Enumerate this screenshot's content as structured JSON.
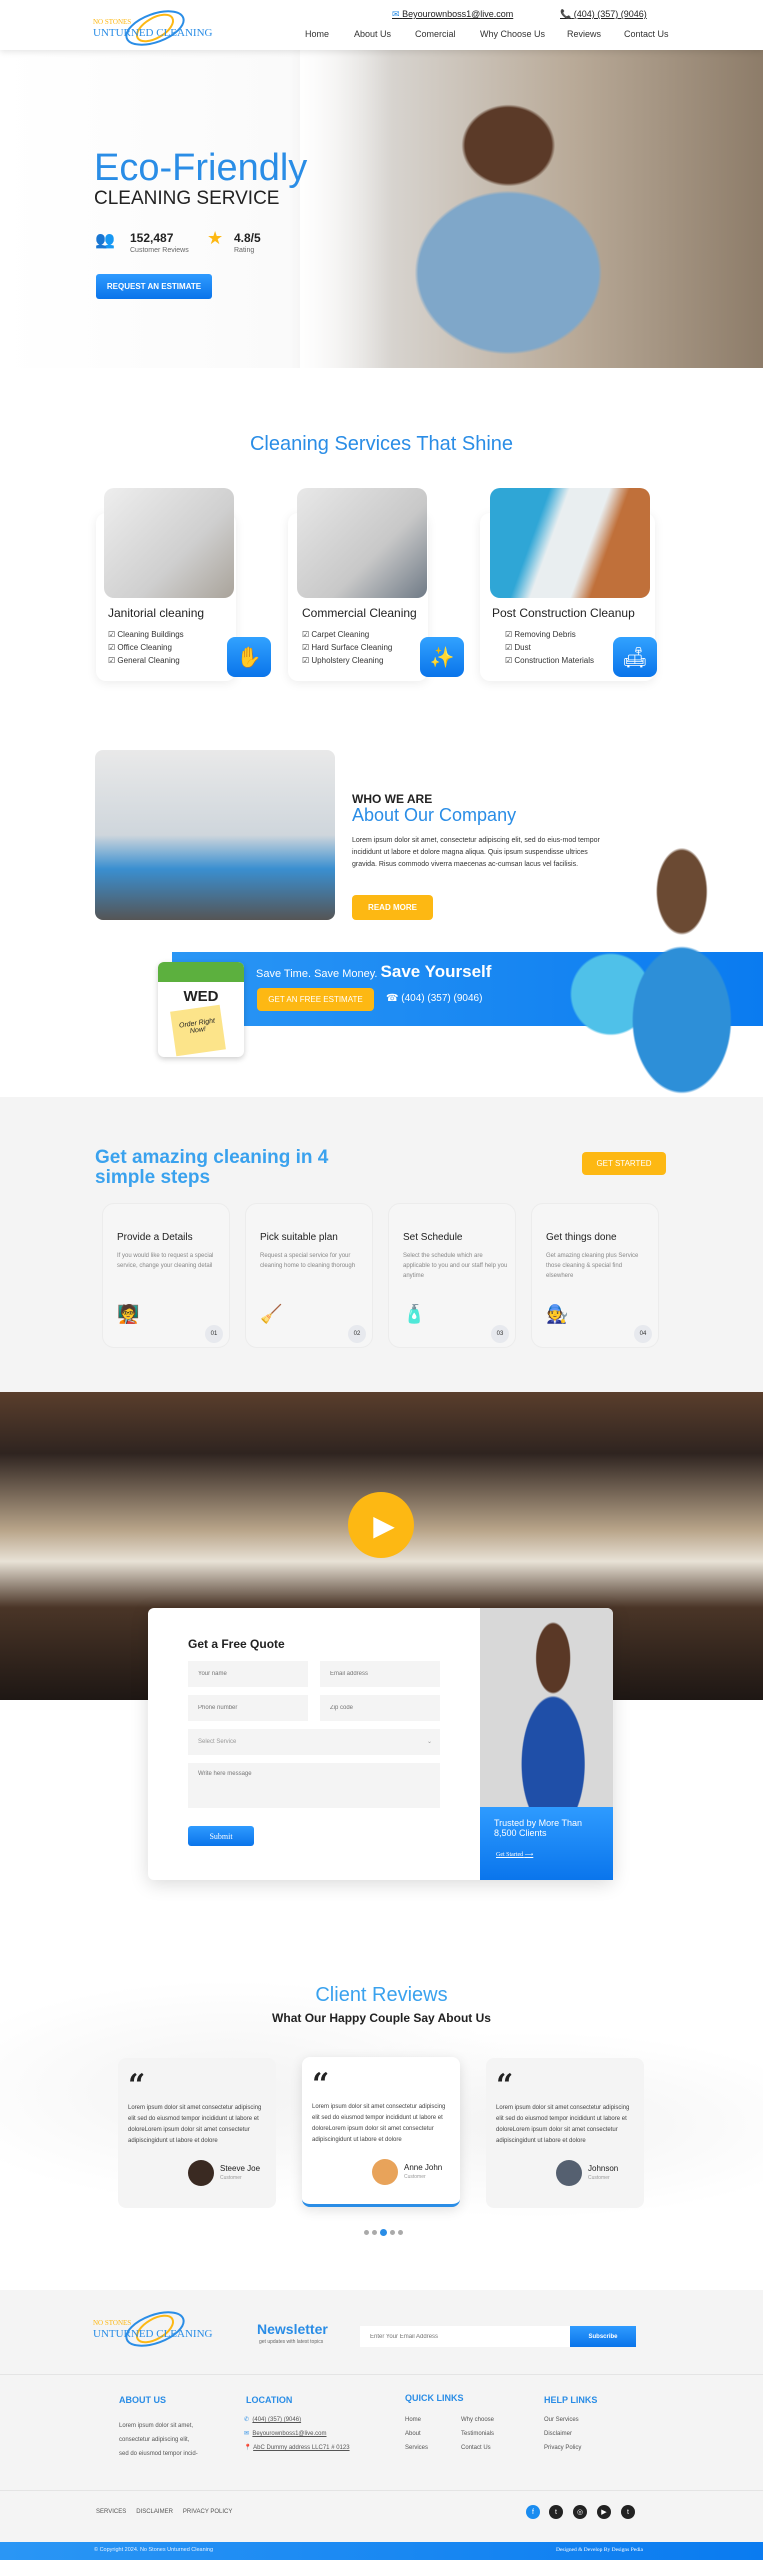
{
  "header": {
    "logo_text": "NO STONES UNTURNED CLEANING",
    "email": "Beyourownboss1@live.com",
    "phone": "(404) (357) (9046)",
    "nav": [
      "Home",
      "About Us",
      "Comercial",
      "Why Choose Us",
      "Reviews",
      "Contact Us"
    ]
  },
  "hero": {
    "title": "Eco-Friendly",
    "subtitle": "CLEANING SERVICE",
    "reviews_count": "152,487",
    "reviews_label": "Customer Reviews",
    "rating": "4.8/5",
    "rating_label": "Rating",
    "cta": "REQUEST AN ESTIMATE"
  },
  "services": {
    "title": "Cleaning Services That Shine",
    "cards": [
      {
        "title": "Janitorial cleaning",
        "items": [
          "Cleaning Buildings",
          "Office Cleaning",
          "General Cleaning"
        ],
        "icon": "hand-wipe-icon"
      },
      {
        "title": "Commercial Cleaning",
        "items": [
          "Carpet Cleaning",
          "Hard Surface Cleaning",
          "Upholstery Cleaning"
        ],
        "icon": "office-sparkle-icon"
      },
      {
        "title": "Post Construction Cleanup",
        "items": [
          "Removing Debris",
          "Dust",
          "Construction Materials"
        ],
        "icon": "sofa-clean-icon"
      }
    ]
  },
  "about": {
    "eyebrow": "WHO WE ARE",
    "title": "About Our Company",
    "body": "Lorem ipsum dolor sit amet, consectetur adipiscing elit, sed do eius-mod tempor incididunt ut labore et dolore magna aliqua. Quis ipsum suspendisse ultrices gravida. Risus commodo viverra maecenas ac-cumsan lacus vel facilisis.",
    "button": "READ MORE"
  },
  "banner": {
    "tagline": "Save Time. Save Money.",
    "tagline_bold": "Save Yourself",
    "button": "GET AN FREE ESTIMATE",
    "phone": "(404) (357) (9046)",
    "calendar_day": "WED",
    "note": "Order Right Now!"
  },
  "steps": {
    "title": "Get amazing cleaning in 4 simple steps",
    "button": "GET STARTED",
    "items": [
      {
        "title": "Provide a Details",
        "text": "If you would like to request a special service, change your cleaning detail",
        "num": "01"
      },
      {
        "title": "Pick suitable plan",
        "text": "Request a special service for your cleaning home to cleaning thorough",
        "num": "02"
      },
      {
        "title": "Set Schedule",
        "text": "Select the schedule which are applicable to you and our staff help you anytime",
        "num": "03"
      },
      {
        "title": "Get things done",
        "text": "Get amazing cleaning plus Service those cleaning & special find elsewhere",
        "num": "04"
      }
    ]
  },
  "quote": {
    "title": "Get a Free Quote",
    "name_ph": "Your name",
    "email_ph": "Email address",
    "phone_ph": "Phone number",
    "zip_ph": "Zip code",
    "service_ph": "Select Service",
    "message_ph": "Write here message",
    "submit": "Submit",
    "trusted": "Trusted by More Than 8,500 Clients",
    "get_started": "Get Started"
  },
  "reviews": {
    "title": "Client Reviews",
    "subtitle": "What Our Happy Couple Say About Us",
    "items": [
      {
        "text": "Lorem ipsum dolor sit amet consectetur adipiscing elit sed do eiusmod tempor incididunt ut labore et doloreLorem ipsum dolor sit amet consectetur adipiscingidunt ut labore et dolore",
        "name": "Steeve Joe",
        "role": "Customer"
      },
      {
        "text": "Lorem ipsum dolor sit amet consectetur adipiscing elit sed do eiusmod tempor incididunt ut labore et doloreLorem ipsum dolor sit amet consectetur adipiscingidunt ut labore et dolore",
        "name": "Anne John",
        "role": "Customer"
      },
      {
        "text": "Lorem ipsum dolor sit amet consectetur adipiscing elit sed do eiusmod tempor incididunt ut labore et doloreLorem ipsum dolor sit amet consectetur adipiscingidunt ut labore et dolore",
        "name": "Johnson",
        "role": "Customer"
      }
    ]
  },
  "footer": {
    "newsletter_title": "Newsletter",
    "newsletter_sub": "get updates with latest topics",
    "email_ph": "Enter Your Email Address",
    "subscribe": "Subscribe",
    "about_title": "ABOUT US",
    "about_text": "Lorem ipsum dolor sit amet, consectetur adipiscing elit, sed do eiusmod tempor incid-",
    "location_title": "LOCATION",
    "phone": "(404) (357) (9046)",
    "email": "Beyourownboss1@live.com",
    "address": "AbC Dummy address LLC71 # 0123",
    "quick_title": "QUICK LINKS",
    "quick": [
      "Home",
      "About",
      "Services",
      "Why choose",
      "Testimonials",
      "Contact Us"
    ],
    "help_title": "HELP LINKS",
    "help": [
      "Our Services",
      "Disclaimer",
      "Privacy Policy"
    ],
    "bottom_links": [
      "SERVICES",
      "DISCLAIMER",
      "PRIVACY POLICY"
    ],
    "social": [
      "facebook",
      "twitter",
      "instagram",
      "youtube",
      "tumblr"
    ],
    "copyright": "© Copyright 2024. No Stones Unturned Cleaning",
    "credit": "Designed & Develop By  Designs Pedia"
  },
  "colors": {
    "primary": "#2a8de6",
    "accent": "#fdb813"
  }
}
